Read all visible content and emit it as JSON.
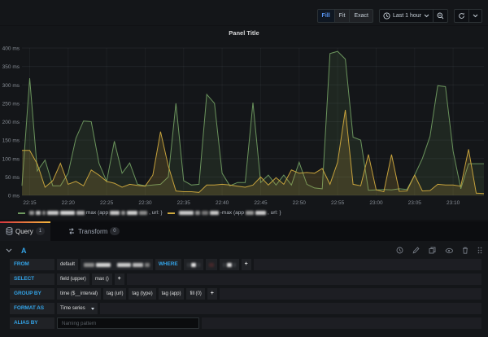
{
  "toolbar": {
    "fill_label": "Fill",
    "fit_label": "Fit",
    "exact_label": "Exact",
    "time_range_label": "Last 1 hour"
  },
  "panel": {
    "title": "Panel Title"
  },
  "chart_data": {
    "type": "line",
    "title": "Panel Title",
    "x_start": "22:14",
    "x_step_minutes": 1,
    "x_tick_labels": [
      "22:15",
      "22:20",
      "22:25",
      "22:30",
      "22:35",
      "22:40",
      "22:45",
      "22:50",
      "22:55",
      "23:00",
      "23:05",
      "23:10"
    ],
    "x_tick_minutes": [
      1,
      6,
      11,
      16,
      21,
      26,
      31,
      36,
      41,
      46,
      51,
      56
    ],
    "y_unit": "ms",
    "y_ticks": [
      0,
      50,
      100,
      150,
      200,
      250,
      300,
      350,
      400
    ],
    "ylim": [
      0,
      400
    ],
    "grid": true,
    "legend_position": "bottom",
    "series": [
      {
        "name": "max (app: [redacted], url: [redacted] }",
        "color": "#6f9a60",
        "fill_opacity": 0.13,
        "values": [
          26,
          318,
          66,
          96,
          26,
          26,
          60,
          155,
          202,
          200,
          87,
          38,
          147,
          60,
          88,
          30,
          26,
          28,
          30,
          50,
          250,
          40,
          28,
          30,
          274,
          250,
          60,
          26,
          35,
          35,
          252,
          35,
          55,
          28,
          55,
          28,
          90,
          30,
          20,
          18,
          385,
          391,
          370,
          158,
          150,
          14,
          15,
          16,
          15,
          18,
          16,
          55,
          100,
          160,
          298,
          295,
          120,
          18,
          86,
          86,
          86
        ]
      },
      {
        "name": "-max (app: [redacted], url: [redacted] }",
        "color": "#cfa93e",
        "fill_opacity": 0.18,
        "values": [
          122,
          122,
          85,
          22,
          40,
          87,
          30,
          38,
          26,
          69,
          55,
          38,
          33,
          22,
          30,
          27,
          25,
          55,
          173,
          80,
          12,
          10,
          10,
          8,
          28,
          28,
          30,
          28,
          25,
          22,
          28,
          50,
          28,
          48,
          30,
          69,
          60,
          62,
          60,
          73,
          30,
          90,
          232,
          30,
          26,
          111,
          15,
          10,
          111,
          11,
          12,
          55,
          12,
          13,
          30,
          28,
          28,
          25,
          125,
          6,
          5
        ]
      }
    ]
  },
  "legend": {
    "item_a_prefix": "max (app",
    "item_a_suffix": ", url: }",
    "item_b_prefix": "-max (app",
    "item_b_suffix": ", url: }"
  },
  "tabs": {
    "query_label": "Query",
    "query_count": "1",
    "transform_label": "Transform",
    "transform_count": "0"
  },
  "query": {
    "ref_id": "A",
    "from_label": "FROM",
    "from_policy": "default",
    "where_label": "WHERE",
    "select_label": "SELECT",
    "select_parts": [
      "field (upper)",
      "max ()"
    ],
    "group_by_label": "GROUP BY",
    "group_by_parts": [
      "time ($__interval)",
      "tag (url)",
      "tag (type)",
      "tag (app)",
      "fill (0)"
    ],
    "format_as_label": "FORMAT AS",
    "format_as_value": "Time series",
    "alias_by_label": "ALIAS BY",
    "alias_by_placeholder": "Naming pattern",
    "plus": "+"
  }
}
